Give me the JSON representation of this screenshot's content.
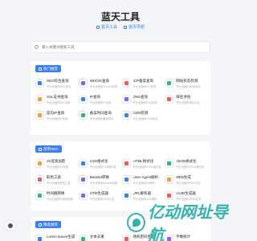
{
  "header": {
    "title": "蓝天工具",
    "links": [
      {
        "label": "首页工具",
        "icon": "home-icon"
      },
      {
        "label": "首页导航",
        "icon": "grid-icon"
      }
    ]
  },
  "search": {
    "placeholder": "输入关键词搜索工具"
  },
  "sections": [
    {
      "label": "热门推荐",
      "icon": "fire-icon",
      "items": [
        {
          "name": "SEO综合查询",
          "desc": "专业全面的SEO查询",
          "color": "#3a7ef0"
        },
        {
          "name": "WHOIS查询",
          "desc": "专业全面的WHOIS查询",
          "color": "#8a63e8"
        },
        {
          "name": "ICP备案查询",
          "desc": "专业全面的ICP查询",
          "color": "#f05a5a"
        },
        {
          "name": "网站状态检测",
          "desc": "专业全面的状态检测",
          "color": "#36b37e"
        },
        {
          "name": "SSL证书查询",
          "desc": "专业全面的SSL查询",
          "color": "#f0a030"
        },
        {
          "name": "IP查询",
          "desc": "专业全面的IP查询",
          "color": "#3a7ef0"
        },
        {
          "name": "DNS查询",
          "desc": "专业全面的DNS查询",
          "color": "#8a63e8"
        },
        {
          "name": "域名评估",
          "desc": "专业全面的域名评估",
          "color": "#f05a5a"
        },
        {
          "name": "反向IP查询",
          "desc": "专业全面的IP查询",
          "color": "#f0a030"
        },
        {
          "name": "备案时间查询",
          "desc": "专业全面的备案查询",
          "color": "#36b37e"
        },
        {
          "name": "CDN检测",
          "desc": "专业全面的CDN检测",
          "color": "#3a7ef0"
        }
      ]
    },
    {
      "label": "常用SEO",
      "icon": "refresh-icon",
      "items": [
        {
          "name": "JS混淆加密",
          "desc": "专业全面的JS混淆",
          "color": "#f0a030"
        },
        {
          "name": "CSS格式化",
          "desc": "专业全面的CSS格式化",
          "color": "#3a7ef0"
        },
        {
          "name": "HTML格式化",
          "desc": "专业全面的HTML格式化",
          "color": "#f05a5a"
        },
        {
          "name": "JSON格式化",
          "desc": "专业全面的JSON格式化",
          "color": "#36b37e"
        },
        {
          "name": "取色工具",
          "desc": "专业全面的取色工具",
          "color": "#f05a5a"
        },
        {
          "name": "Base64转换",
          "desc": "专业全面的Base64转换",
          "color": "#8a63e8"
        },
        {
          "name": "User-Agent解析",
          "desc": "专业全面的UA解析",
          "color": "#3a7ef0"
        },
        {
          "name": "MD5生成",
          "desc": "专业全面的MD5生成",
          "color": "#f0a030"
        },
        {
          "name": "时间戳转换",
          "desc": "专业全面的时间戳转换",
          "color": "#36b37e"
        },
        {
          "name": "UTM生成器",
          "desc": "专业全面的UTM生成",
          "color": "#8a63e8"
        },
        {
          "name": "URL解析器",
          "desc": "专业全面的URL解析",
          "color": "#3a7ef0"
        },
        {
          "name": "UUID生成器",
          "desc": "专业全面的UUID生成",
          "color": "#f05a5a"
        }
      ]
    },
    {
      "label": "精选推荐",
      "icon": "star-icon",
      "items": [
        {
          "name": "Lorem Ipsum生成",
          "desc": "专业全面的文本生成",
          "color": "#3a7ef0"
        },
        {
          "name": "文本去重",
          "desc": "专业全面的文本去重",
          "color": "#36b37e"
        },
        {
          "name": "随机密码生成",
          "desc": "专业全面的密码生成",
          "color": "#f05a5a"
        },
        {
          "name": "字数统计",
          "desc": "专业全面的字数统计",
          "color": "#8a63e8"
        }
      ]
    }
  ],
  "watermark": "亿动网址导航"
}
